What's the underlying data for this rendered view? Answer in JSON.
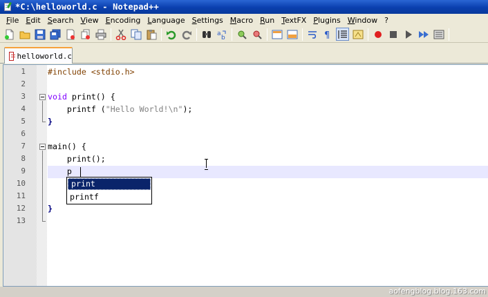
{
  "window": {
    "title": "*C:\\helloworld.c - Notepad++"
  },
  "menu": [
    "File",
    "Edit",
    "Search",
    "View",
    "Encoding",
    "Language",
    "Settings",
    "Macro",
    "Run",
    "TextFX",
    "Plugins",
    "Window",
    "?"
  ],
  "tab": {
    "label": "helloworld.c"
  },
  "editor": {
    "line_numbers": [
      "1",
      "2",
      "3",
      "4",
      "5",
      "6",
      "7",
      "8",
      "9",
      "10",
      "11",
      "12",
      "13"
    ],
    "lines": {
      "l1": "#include <stdio.h>",
      "l3_kw": "void",
      "l3_rest": " print() {",
      "l4_a": "    printf (",
      "l4_str": "\"Hello World!\\n\"",
      "l4_b": ");",
      "l5": "}",
      "l7": "main() {",
      "l8": "    print();",
      "l9": "    p",
      "l12": "}"
    }
  },
  "autocomplete": {
    "items": [
      "print",
      "printf"
    ],
    "selected": "print"
  },
  "watermark": "aofengblog.blog.163.com",
  "colors": {
    "keyword": "#8000ff",
    "preprocessor": "#804000",
    "string": "#808080",
    "operator": "#000080",
    "current_line": "#e8e8ff",
    "selection": "#0a246a"
  }
}
